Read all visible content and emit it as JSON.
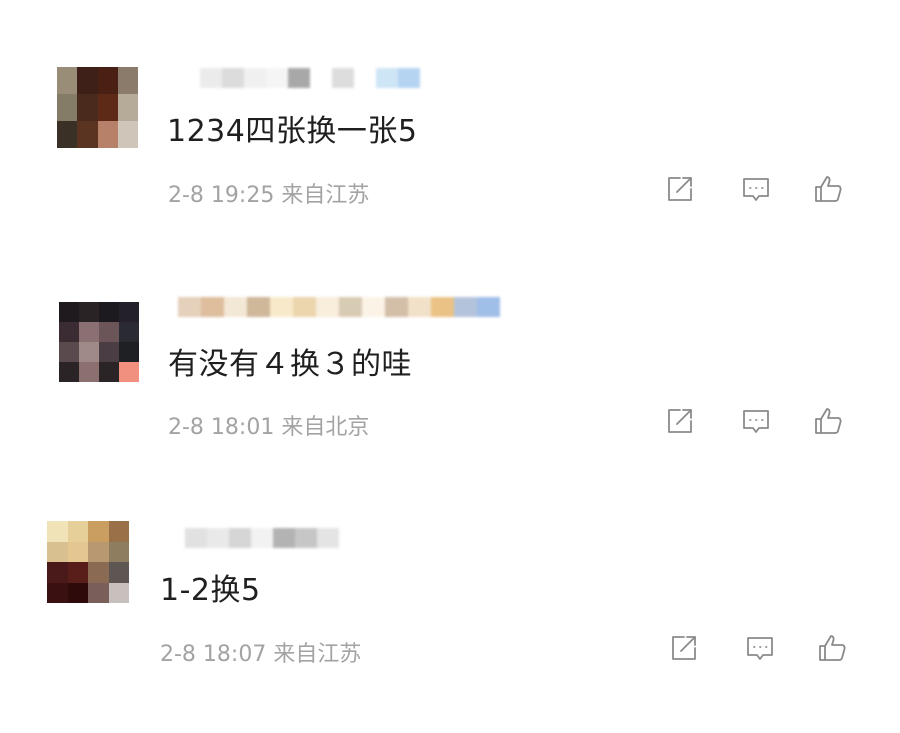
{
  "comments": [
    {
      "content": "1234四张换一张5",
      "meta": "2-8 19:25 来自江苏",
      "actions": {
        "share_icon": "share-icon",
        "reply_icon": "comment-icon",
        "like_icon": "thumbs-up-icon"
      },
      "avatar_colors": [
        "#9a8d78",
        "#3f2018",
        "#4a2015",
        "#8a7b6b",
        "#857c68",
        "#4a2a1c",
        "#5c2a16",
        "#b6aa98",
        "#3a3026",
        "#5a3420",
        "#b78068",
        "#cfc5b8"
      ],
      "name_blur_colors": [
        "#ffffff",
        "#e8e8e8",
        "#d6d6d6",
        "#eeeeee",
        "#f4f4f4",
        "#9a9a9a",
        "#ffffff",
        "#d8d8d8",
        "#ffffff",
        "#c6e1f5",
        "#a9cdf0"
      ]
    },
    {
      "content": "有没有４换３的哇",
      "meta": "2-8 18:01 来自北京",
      "actions": {
        "share_icon": "share-icon",
        "reply_icon": "comment-icon",
        "like_icon": "thumbs-up-icon"
      },
      "avatar_colors": [
        "#1e1a1e",
        "#2a2326",
        "#1c1a1f",
        "#23202a",
        "#3a2c32",
        "#8a6f73",
        "#6b5559",
        "#2a2a32",
        "#5a4a4e",
        "#a08a88",
        "#4a3e44",
        "#1e2024",
        "#2b2426",
        "#8c7070",
        "#2a2426",
        "#f29080"
      ],
      "name_blur_colors": [
        "#e0c8b0",
        "#d9b38d",
        "#f2e3d0",
        "#c7ab88",
        "#f7e6c2",
        "#e8cfa0",
        "#f8ead5",
        "#d2c2a8",
        "#fbf1e2",
        "#ccb49a",
        "#f0dcc0",
        "#e7b870",
        "#a7b9d6",
        "#8fb3e4"
      ]
    },
    {
      "content": "1-2换5",
      "meta": "2-8 18:07 来自江苏",
      "actions": {
        "share_icon": "share-icon",
        "reply_icon": "comment-icon",
        "like_icon": "thumbs-up-icon"
      },
      "avatar_colors": [
        "#f0e3b8",
        "#e6cf99",
        "#c99e60",
        "#9a7048",
        "#d8c090",
        "#e4c690",
        "#b89870",
        "#8e7d5e",
        "#4a1a1a",
        "#5a1e1a",
        "#8a6a52",
        "#5e5652",
        "#3a1010",
        "#2e0a0a",
        "#7a5e5a",
        "#c8c0bc"
      ],
      "name_blur_colors": [
        "#ffffff",
        "#dcdcdc",
        "#e6e6e6",
        "#cfcfcf",
        "#f0f0f0",
        "#a6a6a6",
        "#bdbdbd",
        "#e0e0e0",
        "#ffffff"
      ]
    }
  ]
}
